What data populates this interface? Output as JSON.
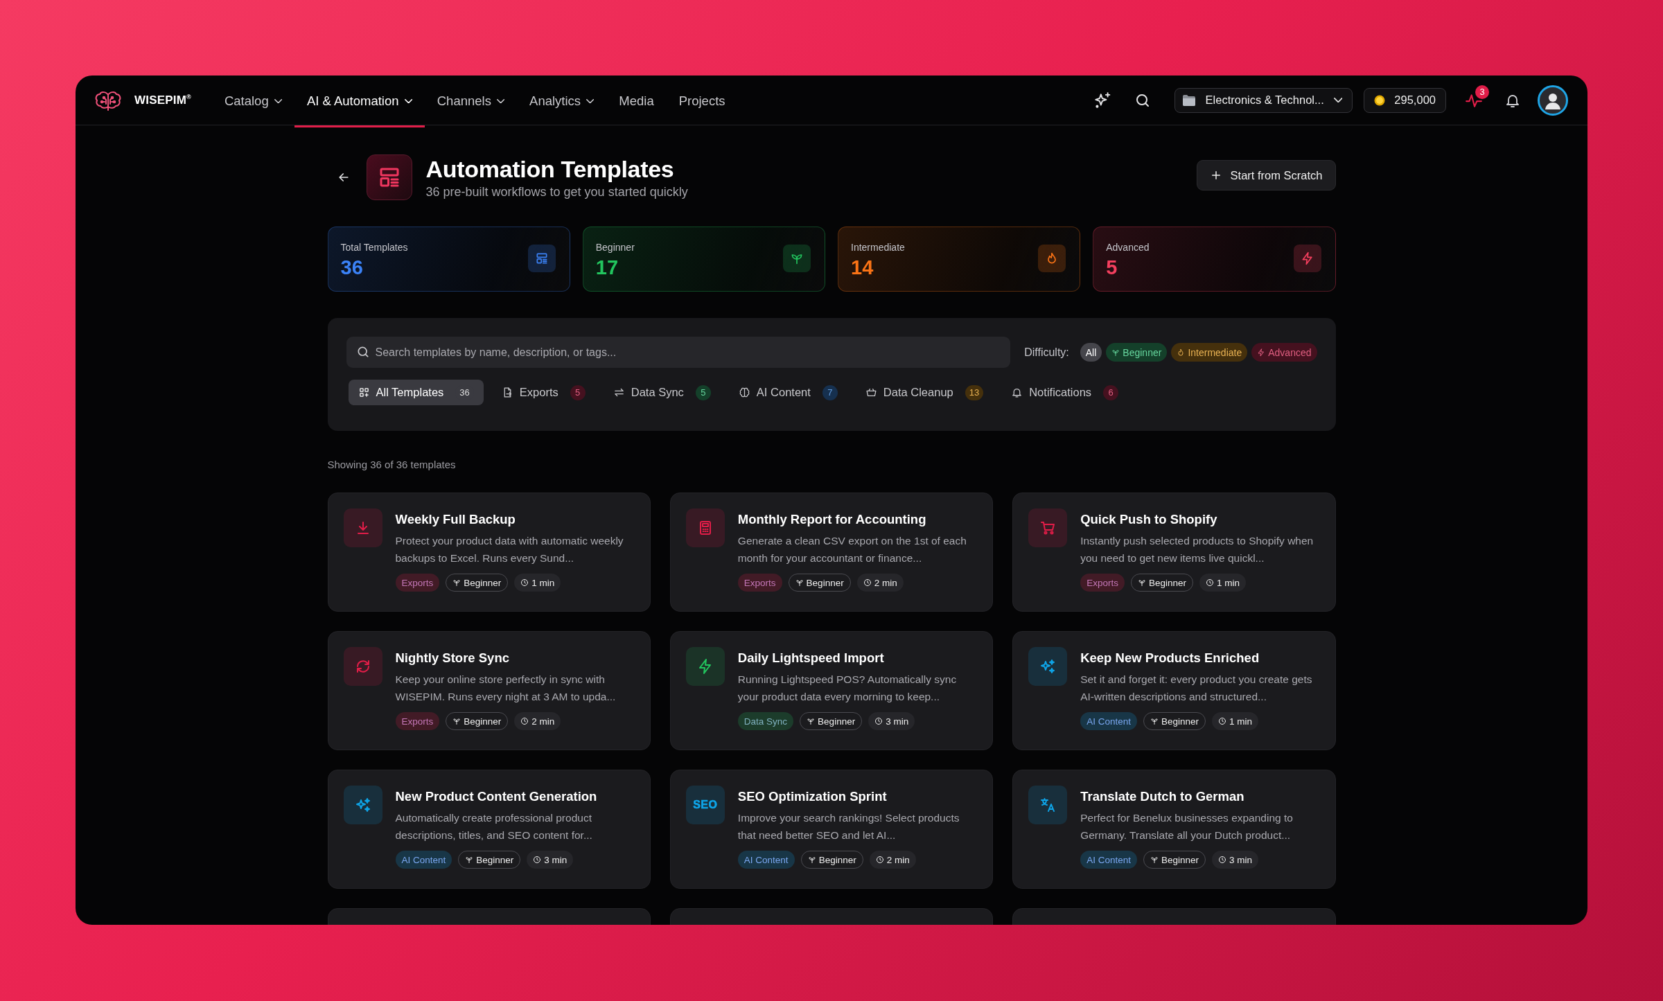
{
  "nav": {
    "brand": "WISEPIM$^{®}$",
    "items": [
      {
        "label": "Catalog",
        "dropdown": true,
        "selected": false
      },
      {
        "label": "AI & Automation",
        "dropdown": true,
        "selected": true
      },
      {
        "label": "Channels",
        "dropdown": true,
        "selected": false
      },
      {
        "label": "Analytics",
        "dropdown": true,
        "selected": false
      },
      {
        "label": "Media",
        "dropdown": false,
        "selected": false
      },
      {
        "label": "Projects",
        "dropdown": false,
        "selected": false
      }
    ],
    "workspace": "Electronics & Technol...",
    "credits": "295,000",
    "activity_badge": "3"
  },
  "header": {
    "title": "Automation Templates",
    "subtitle": "36 pre-built workflows to get you started quickly",
    "action": "Start from Scratch"
  },
  "stats": [
    {
      "label": "Total Templates",
      "value": "36",
      "color": "#3b82f6"
    },
    {
      "label": "Beginner",
      "value": "17",
      "color": "#22c55e"
    },
    {
      "label": "Intermediate",
      "value": "14",
      "color": "#f97316"
    },
    {
      "label": "Advanced",
      "value": "5",
      "color": "#f43f5e"
    }
  ],
  "filters": {
    "search": {
      "placeholder": "Search templates by name, description, or tags..."
    },
    "difficulty_label": "Difficulty:",
    "difficulty": [
      {
        "label": "All",
        "color": "#45454b",
        "selected": true
      },
      {
        "label": "Beginner",
        "color": "#14402a",
        "selected": false
      },
      {
        "label": "Intermediate",
        "color": "#45300c",
        "selected": false
      },
      {
        "label": "Advanced",
        "color": "#45111f",
        "selected": false
      }
    ],
    "categories": [
      {
        "label": "All Templates",
        "count": "36",
        "color": "#3a3a40",
        "selected": true
      },
      {
        "label": "Exports",
        "count": "5",
        "color": "#45111f",
        "selected": false
      },
      {
        "label": "Data Sync",
        "count": "5",
        "color": "#14402a",
        "selected": false
      },
      {
        "label": "AI Content",
        "count": "7",
        "color": "#16304f",
        "selected": false
      },
      {
        "label": "Data Cleanup",
        "count": "13",
        "color": "#45300c",
        "selected": false
      },
      {
        "label": "Notifications",
        "count": "6",
        "color": "#45111f",
        "selected": false
      }
    ]
  },
  "result_count": "Showing 36 of 36 templates",
  "templates": [
    {
      "kind": "card",
      "title": "Weekly Full Backup",
      "description": "Protect your product data with automatic weekly backups to Excel. Runs every Sund...",
      "category": "Exports",
      "color": "#e11d48",
      "difficulty": "Beginner",
      "duration": "1 min"
    },
    {
      "kind": "card",
      "title": "Monthly Report for Accounting",
      "description": "Generate a clean CSV export on the 1st of each month for your accountant or finance...",
      "category": "Exports",
      "color": "#e11d48",
      "difficulty": "Beginner",
      "duration": "2 min"
    },
    {
      "kind": "card",
      "title": "Quick Push to Shopify",
      "description": "Instantly push selected products to Shopify when you need to get new items live quickl...",
      "category": "Exports",
      "color": "#e11d48",
      "difficulty": "Beginner",
      "duration": "1 min"
    },
    {
      "kind": "card",
      "title": "Nightly Store Sync",
      "description": "Keep your online store perfectly in sync with WISEPIM. Runs every night at 3 AM to upda...",
      "category": "Exports",
      "color": "#e11d48",
      "difficulty": "Beginner",
      "duration": "2 min"
    },
    {
      "kind": "card",
      "title": "Daily Lightspeed Import",
      "description": "Running Lightspeed POS? Automatically sync your product data every morning to keep...",
      "category": "Data Sync",
      "color": "#22c55e",
      "difficulty": "Beginner",
      "duration": "3 min"
    },
    {
      "kind": "card",
      "title": "Keep New Products Enriched",
      "description": "Set it and forget it: every product you create gets AI-written descriptions and structured...",
      "category": "AI Content",
      "color": "#0ea5e9",
      "difficulty": "Beginner",
      "duration": "1 min"
    },
    {
      "kind": "card",
      "title": "New Product Content Generation",
      "description": "Automatically create professional product descriptions, titles, and SEO content for...",
      "category": "AI Content",
      "color": "#0ea5e9",
      "difficulty": "Beginner",
      "duration": "3 min"
    },
    {
      "kind": "card",
      "title": "SEO Optimization Sprint",
      "description": "Improve your search rankings! Select products that need better SEO and let AI...",
      "category": "AI Content",
      "color": "#0ea5e9",
      "icon_text": "SEO",
      "difficulty": "Beginner",
      "duration": "2 min"
    },
    {
      "kind": "card",
      "title": "Translate Dutch to German",
      "description": "Perfect for Benelux businesses expanding to Germany. Translate all your Dutch product...",
      "category": "AI Content",
      "color": "#0ea5e9",
      "difficulty": "Beginner",
      "duration": "3 min"
    },
    {
      "kind": "clipped"
    },
    {
      "kind": "clipped"
    },
    {
      "kind": "clipped"
    }
  ]
}
